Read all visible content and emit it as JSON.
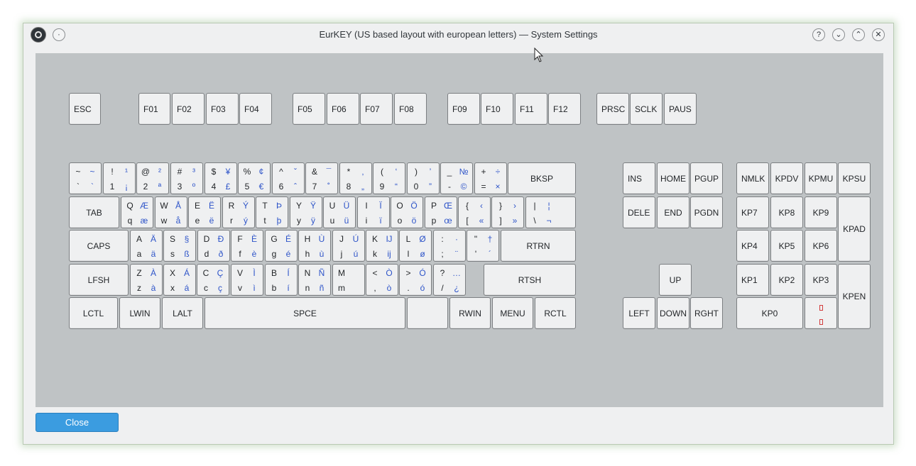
{
  "window": {
    "title": "EurKEY (US based layout with european letters) — System Settings",
    "buttons": {
      "minimize_dot": "·",
      "help": "?",
      "shade": "⌄",
      "maximize": "⌃",
      "close": "✕"
    }
  },
  "keys": [
    {
      "name": "ESC"
    },
    {
      "name": "F01"
    },
    {
      "name": "F02"
    },
    {
      "name": "F03"
    },
    {
      "name": "F04"
    },
    {
      "name": "F05"
    },
    {
      "name": "F06"
    },
    {
      "name": "F07"
    },
    {
      "name": "F08"
    },
    {
      "name": "F09"
    },
    {
      "name": "F10"
    },
    {
      "name": "F11"
    },
    {
      "name": "F12"
    },
    {
      "name": "PRSC"
    },
    {
      "name": "SCLK"
    },
    {
      "name": "PAUS"
    },
    {
      "tl": "~",
      "tr": "~",
      "bl": "`",
      "br": "`"
    },
    {
      "tl": "!",
      "tr": "¹",
      "bl": "1",
      "br": "¡"
    },
    {
      "tl": "@",
      "tr": "²",
      "bl": "2",
      "br": "ª"
    },
    {
      "tl": "#",
      "tr": "³",
      "bl": "3",
      "br": "º"
    },
    {
      "tl": "$",
      "tr": "¥",
      "bl": "4",
      "br": "£"
    },
    {
      "tl": "%",
      "tr": "¢",
      "bl": "5",
      "br": "€"
    },
    {
      "tl": "^",
      "tr": "ˇ",
      "bl": "6",
      "br": "ˆ"
    },
    {
      "tl": "&",
      "tr": "¯",
      "bl": "7",
      "br": "˚"
    },
    {
      "tl": "*",
      "tr": "‚",
      "bl": "8",
      "br": "„"
    },
    {
      "tl": "(",
      "tr": "‘",
      "bl": "9",
      "br": "“"
    },
    {
      "tl": ")",
      "tr": "’",
      "bl": "0",
      "br": "”"
    },
    {
      "tl": "_",
      "tr": "№",
      "bl": "-",
      "br": "©"
    },
    {
      "tl": "+",
      "tr": "÷",
      "bl": "=",
      "br": "×"
    },
    {
      "name": "BKSP"
    },
    {
      "name": "TAB"
    },
    {
      "tl": "Q",
      "tr": "Æ",
      "bl": "q",
      "br": "æ"
    },
    {
      "tl": "W",
      "tr": "Å",
      "bl": "w",
      "br": "å"
    },
    {
      "tl": "E",
      "tr": "Ë",
      "bl": "e",
      "br": "ë"
    },
    {
      "tl": "R",
      "tr": "Ý",
      "bl": "r",
      "br": "ý"
    },
    {
      "tl": "T",
      "tr": "Þ",
      "bl": "t",
      "br": "þ"
    },
    {
      "tl": "Y",
      "tr": "Ÿ",
      "bl": "y",
      "br": "ÿ"
    },
    {
      "tl": "U",
      "tr": "Ü",
      "bl": "u",
      "br": "ü"
    },
    {
      "tl": "I",
      "tr": "Ï",
      "bl": "i",
      "br": "ï"
    },
    {
      "tl": "O",
      "tr": "Ö",
      "bl": "o",
      "br": "ö"
    },
    {
      "tl": "P",
      "tr": "Œ",
      "bl": "p",
      "br": "œ"
    },
    {
      "tl": "{",
      "tr": "‹",
      "bl": "[",
      "br": "«"
    },
    {
      "tl": "}",
      "tr": "›",
      "bl": "]",
      "br": "»"
    },
    {
      "tl": "|",
      "tr": "¦",
      "bl": "\\",
      "br": "¬"
    },
    {
      "name": "CAPS"
    },
    {
      "tl": "A",
      "tr": "Ä",
      "bl": "a",
      "br": "ä"
    },
    {
      "tl": "S",
      "tr": "§",
      "bl": "s",
      "br": "ß"
    },
    {
      "tl": "D",
      "tr": "Ð",
      "bl": "d",
      "br": "ð"
    },
    {
      "tl": "F",
      "tr": "È",
      "bl": "f",
      "br": "è"
    },
    {
      "tl": "G",
      "tr": "É",
      "bl": "g",
      "br": "é"
    },
    {
      "tl": "H",
      "tr": "Ù",
      "bl": "h",
      "br": "ù"
    },
    {
      "tl": "J",
      "tr": "Ú",
      "bl": "j",
      "br": "ú"
    },
    {
      "tl": "K",
      "tr": "Ĳ",
      "bl": "k",
      "br": "ĳ"
    },
    {
      "tl": "L",
      "tr": "Ø",
      "bl": "l",
      "br": "ø"
    },
    {
      "tl": ":",
      "tr": "·",
      "bl": ";",
      "br": "¨"
    },
    {
      "tl": "\"",
      "tr": "†",
      "bl": "'",
      "br": "´"
    },
    {
      "name": "RTRN"
    },
    {
      "name": "LFSH"
    },
    {
      "tl": "Z",
      "tr": "À",
      "bl": "z",
      "br": "à"
    },
    {
      "tl": "X",
      "tr": "Á",
      "bl": "x",
      "br": "á"
    },
    {
      "tl": "C",
      "tr": "Ç",
      "bl": "c",
      "br": "ç"
    },
    {
      "tl": "V",
      "tr": "Ì",
      "bl": "v",
      "br": "ì"
    },
    {
      "tl": "B",
      "tr": "Í",
      "bl": "b",
      "br": "í"
    },
    {
      "tl": "N",
      "tr": "Ñ",
      "bl": "n",
      "br": "ñ"
    },
    {
      "tl": "M",
      "tr": "",
      "bl": "m",
      "br": ""
    },
    {
      "tl": "<",
      "tr": "Ò",
      "bl": ",",
      "br": "ò"
    },
    {
      "tl": ">",
      "tr": "Ó",
      "bl": ".",
      "br": "ó"
    },
    {
      "tl": "?",
      "tr": "…",
      "bl": "/",
      "br": "¿"
    },
    {
      "name": "RTSH"
    },
    {
      "name": "LCTL"
    },
    {
      "name": "LWIN"
    },
    {
      "name": "LALT"
    },
    {
      "name": "SPCE"
    },
    {
      "name": ""
    },
    {
      "name": "RWIN"
    },
    {
      "name": "MENU"
    },
    {
      "name": "RCTL"
    },
    {
      "name": "INS"
    },
    {
      "name": "HOME"
    },
    {
      "name": "PGUP"
    },
    {
      "name": "DELE"
    },
    {
      "name": "END"
    },
    {
      "name": "PGDN"
    },
    {
      "name": "UP"
    },
    {
      "name": "LEFT"
    },
    {
      "name": "DOWN"
    },
    {
      "name": "RGHT"
    },
    {
      "name": "NMLK"
    },
    {
      "name": "KPDV"
    },
    {
      "name": "KPMU"
    },
    {
      "name": "KPSU"
    },
    {
      "name": "KP7"
    },
    {
      "name": "KP8"
    },
    {
      "name": "KP9"
    },
    {
      "name": "KPAD"
    },
    {
      "name": "KP4"
    },
    {
      "name": "KP5"
    },
    {
      "name": "KP6"
    },
    {
      "name": "KP1"
    },
    {
      "name": "KP2"
    },
    {
      "name": "KP3"
    },
    {
      "name": "KPEN"
    },
    {
      "name": "KP0"
    },
    {
      "name": "",
      "red": true
    }
  ],
  "footer": {
    "close_label": "Close"
  },
  "colors": {
    "accent": "#3b9ce0",
    "level3_text": "#2f55c9",
    "keyboard_bg": "#bfc3c5"
  }
}
